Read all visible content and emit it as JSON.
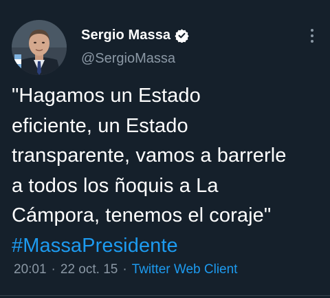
{
  "tweet": {
    "author": {
      "display_name": "Sergio Massa",
      "handle": "@SergioMassa",
      "verified": true,
      "avatar_icon": "profile-photo"
    },
    "text_line_1": "\"Hagamos un Estado",
    "text_line_2": "eficiente, un Estado",
    "text_line_3": "transparente, vamos a barrerle",
    "text_line_4": "a todos los ñoquis a La",
    "text_line_5": "Cámpora, tenemos el coraje\"",
    "hashtag": "#MassaPresidente",
    "time": "20:01",
    "date": "22 oct. 15",
    "separator": "·",
    "source": "Twitter Web Client",
    "more_icon": "more-vertical-icon"
  },
  "colors": {
    "background": "#15202b",
    "text": "#ffffff",
    "secondary_text": "#8b98a5",
    "accent": "#1d9bf0",
    "verified_badge": "#ffffff"
  }
}
